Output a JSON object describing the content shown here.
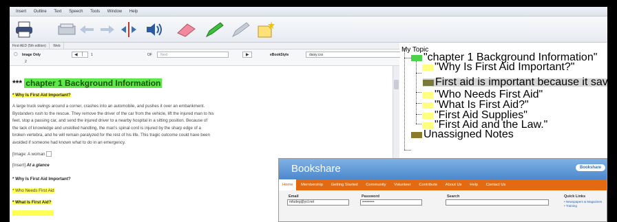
{
  "menu": [
    "Insert",
    "Outline",
    "Text",
    "Speech",
    "Tools",
    "Window",
    "Help"
  ],
  "tabs": [
    "First AED (5th edition)",
    "Web"
  ],
  "nav": {
    "view_label": "Image Only",
    "page_value": "1",
    "of_label": "OF",
    "page_total": "Next",
    "ebookstyle_label": "eBookStyle",
    "ebookstyle_value": "daisy.css",
    "second_line": "2"
  },
  "document": {
    "heading_prefix": "***",
    "heading": "chapter 1 Background Information",
    "subhead1": "* Why Is First Aid Important?",
    "body_lines": [
      "A large truck swings around a corner, crashes into an automobile, and pushes it over an embankment.",
      "Bystanders rush to the rescue. They remove the driver of the car from the vehicle, lift the injured man to his",
      "feet, stop a passing car, and send the injured driver to a nearby hospital in a sitting position. Because of",
      "the lack of knowledge and unskilled handling, the man's spinal cord is injured by the sharp edge of a",
      "broken vertebra, and he will remain paralyzed for the rest of his life. This tragic outcome could have been",
      "avoided if someone had known what to do in an emergency."
    ],
    "image_line": "[Image: A woman",
    "insert_prefix": "[Insert]",
    "insert_text": "At a glance",
    "item1": "* Why Is First Aid Important?",
    "item2": "* Who Needs First Aid",
    "item3": "* What Is First Aid?"
  },
  "outline": {
    "root": "My Topic",
    "chapter": "\"chapter 1 Background Information\"",
    "items": [
      "\"Why Is First Aid Important?\"",
      "First aid is important because it saves lives.",
      "\"Who Needs First Aid\"",
      "\"What Is First Aid?\"",
      "\"First Aid Supplies\"",
      "\"First Aid and the Law.\""
    ],
    "unassigned": "Unassigned Notes"
  },
  "bookshare": {
    "logo": "Bookshare",
    "brand": "Bookshare",
    "nav": [
      "Home",
      "Membership",
      "Getting Started",
      "Community",
      "Volunteer",
      "Contribute",
      "About Us",
      "Help",
      "Contact Us"
    ],
    "email_label": "Email",
    "email_value": "mfudeg@ycl.net",
    "password_label": "Password",
    "password_value": "••••••••••",
    "search_label": "Search",
    "quick_links_label": "Quick Links",
    "quick_link1": "• Newspapers & Magazines",
    "quick_link2": "• Training"
  },
  "colors": {
    "heading_highlight": "#5ee84a",
    "yellow_highlight": "#ffff55",
    "bookshare_nav": "#e46a12",
    "bookshare_top": "#4c88cc"
  },
  "icons": [
    "print-icon",
    "scan-icon",
    "back-arrow-icon",
    "forward-arrow-icon",
    "split-icon",
    "speaker-icon",
    "eraser-icon",
    "green-highlighter-icon",
    "pen-icon",
    "new-note-icon"
  ]
}
